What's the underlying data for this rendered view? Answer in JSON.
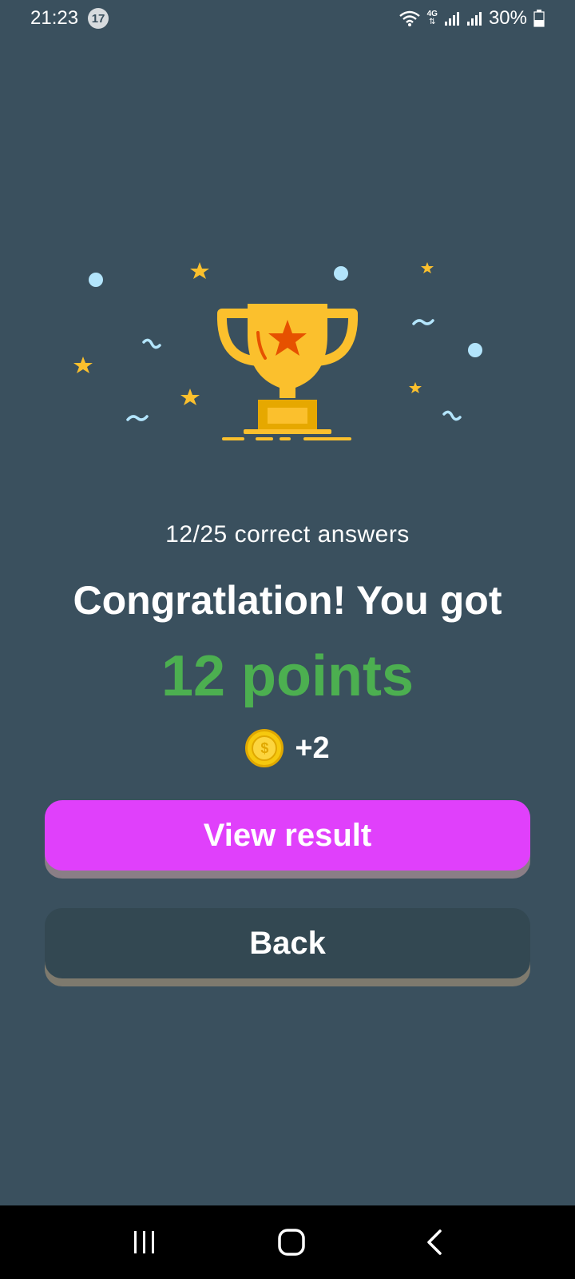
{
  "status_bar": {
    "time": "21:23",
    "notification_count": "17",
    "network_label": "4G",
    "battery": "30%"
  },
  "result": {
    "answers_summary": "12/25 correct answers",
    "congrats": "Congratlation! You got",
    "points": "12 points",
    "coin_symbol": "$",
    "coin_reward": "+2"
  },
  "buttons": {
    "view_result": "View result",
    "back": "Back"
  },
  "colors": {
    "background": "#3a505e",
    "points_green": "#4caf50",
    "view_button": "#e040fb",
    "back_button": "#334852",
    "trophy": "#fbc02d"
  },
  "icons": {
    "trophy": "trophy-icon",
    "coin": "coin-icon",
    "nav_recents": "recents-icon",
    "nav_home": "home-icon",
    "nav_back": "back-icon"
  }
}
